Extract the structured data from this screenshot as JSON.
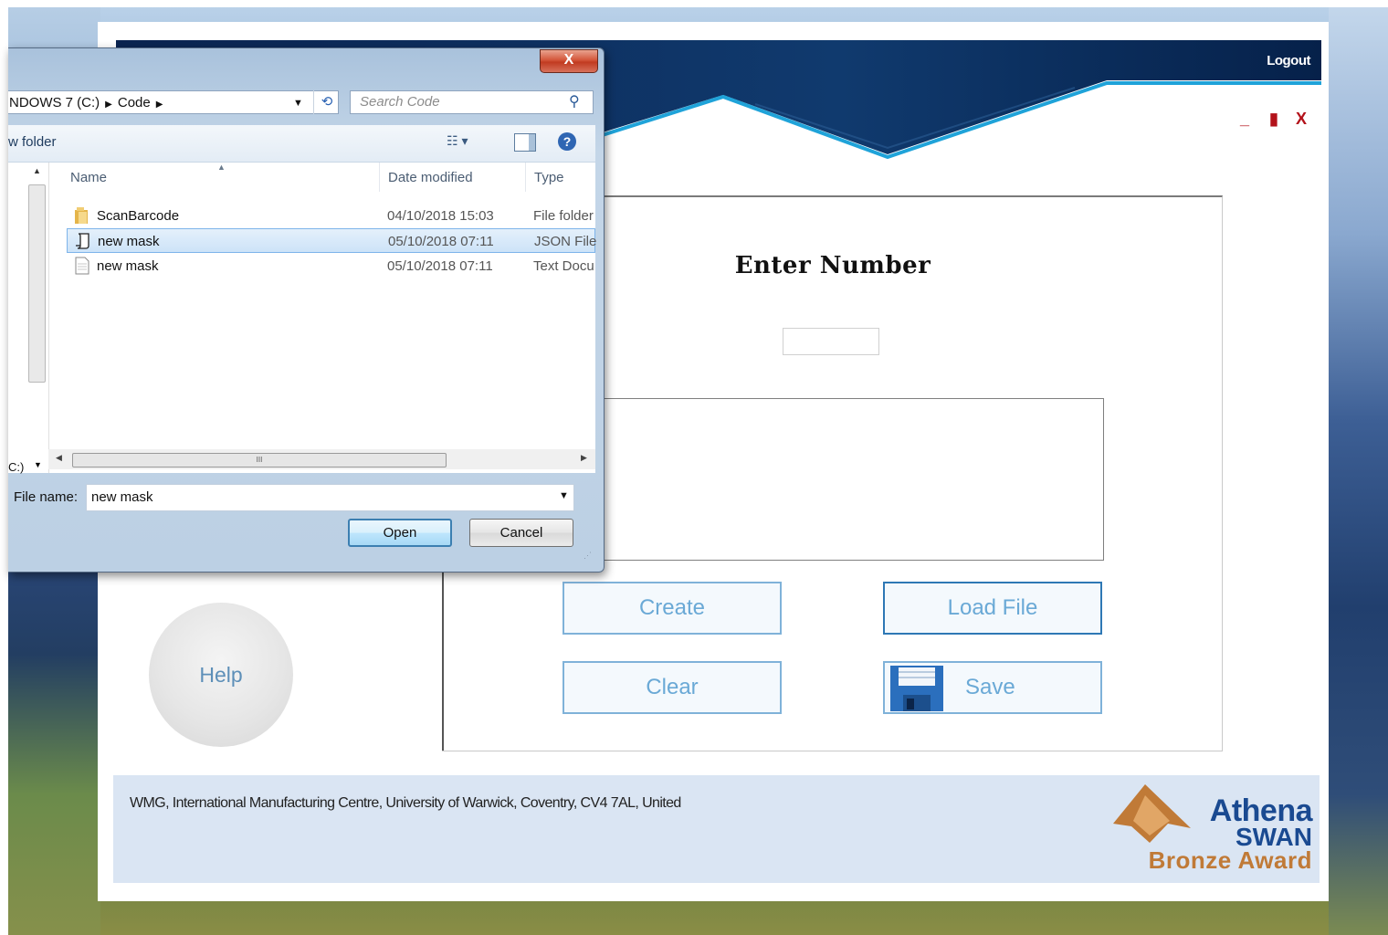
{
  "app": {
    "logout_label": "Logout",
    "window_controls": {
      "minimize": "_",
      "restore": "▮",
      "close": "X"
    },
    "enter_number_title": "Enter Number",
    "number_value": "",
    "buttons": {
      "create": "Create",
      "load_file": "Load File",
      "clear": "Clear",
      "save": "Save",
      "help": "Help"
    },
    "footer_text": "WMG, International Manufacturing Centre, University of Warwick, Coventry, CV4 7AL, United",
    "logo": {
      "line1": "Athena",
      "line2": "SWAN",
      "line3": "Bronze Award"
    },
    "colors": {
      "banner_dark": "#0f2a55",
      "banner_accent": "#1e9fd6",
      "button_text": "#6aa9d6",
      "footer_bg": "#dae5f3"
    }
  },
  "dialog": {
    "close_label": "X",
    "breadcrumb": [
      "NDOWS 7 (C:)",
      "Code"
    ],
    "search_placeholder": "Search Code",
    "toolbar_left": "w folder",
    "columns": {
      "name": "Name",
      "date": "Date modified",
      "type": "Type"
    },
    "files": [
      {
        "name": "ScanBarcode",
        "date": "04/10/2018 15:03",
        "type": "File folder",
        "icon": "folder-icon",
        "selected": false
      },
      {
        "name": "new mask",
        "date": "05/10/2018 07:11",
        "type": "JSON File",
        "icon": "json-file-icon",
        "selected": true
      },
      {
        "name": "new mask",
        "date": "05/10/2018 07:11",
        "type": "Text Docu",
        "icon": "text-file-icon",
        "selected": false
      }
    ],
    "nav_drive_label": "C:)",
    "filename_label": "File name:",
    "filename_value": "new mask",
    "open_label": "Open",
    "cancel_label": "Cancel"
  }
}
